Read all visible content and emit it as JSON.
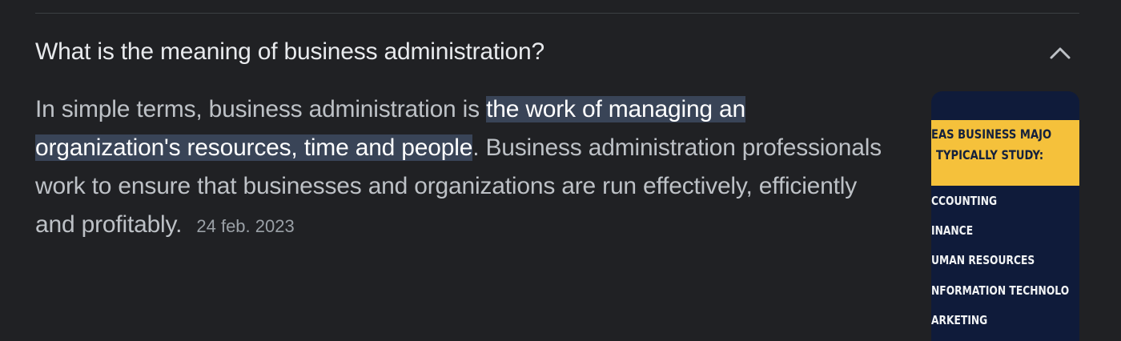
{
  "faq": {
    "question": "What is the meaning of business administration?",
    "answer": {
      "before": "In simple terms, business administration is ",
      "highlight": "the work of managing an organization's resources, time and people",
      "after": ". Business administration professionals work to ensure that businesses and organizations are run effectively, efficiently and profitably.",
      "date": "24 feb. 2023"
    },
    "toggle_icon": "chevron-up-icon",
    "thumbnail": {
      "title_line1": "EAS BUSINESS MAJO",
      "title_line2": "TYPICALLY STUDY:",
      "items": [
        "CCOUNTING",
        "INANCE",
        "UMAN RESOURCES",
        "NFORMATION TECHNOLO",
        "ARKETING"
      ],
      "colors": {
        "header": "#f5c13b",
        "background": "#0f1b3a"
      }
    }
  },
  "colors": {
    "background": "#202124",
    "question_text": "#e8eaed",
    "answer_text": "#bdc1c6",
    "highlight_bg": "#394457"
  }
}
